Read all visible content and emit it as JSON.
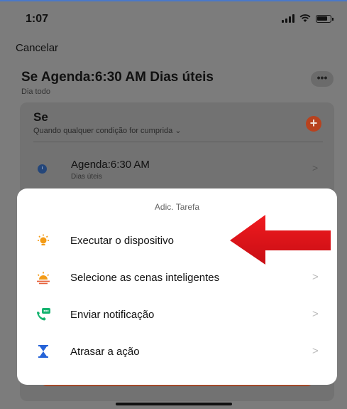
{
  "status_bar": {
    "time": "1:07"
  },
  "header": {
    "cancel_label": "Cancelar"
  },
  "rule": {
    "title": "Se Agenda:6:30 AM Dias úteis",
    "subtitle": "Dia todo",
    "more_label": "•••"
  },
  "condition_section": {
    "title": "Se",
    "subtitle": "Quando qualquer condição for cumprida ⌄",
    "add_label": "+",
    "item": {
      "label": "Agenda:6:30 AM",
      "sub": "Dias úteis",
      "chevron": ">"
    }
  },
  "sheet": {
    "title": "Adic. Tarefa",
    "items": [
      {
        "label": "Executar o dispositivo",
        "icon": "device-icon",
        "chevron": ""
      },
      {
        "label": "Selecione as cenas inteligentes",
        "icon": "scene-icon",
        "chevron": ">"
      },
      {
        "label": "Enviar notificação",
        "icon": "notification-icon",
        "chevron": ">"
      },
      {
        "label": "Atrasar a ação",
        "icon": "hourglass-icon",
        "chevron": ">"
      }
    ]
  },
  "colors": {
    "accent_orange": "#f39b16",
    "notification_green": "#15b36f",
    "hourglass_blue": "#2563d8",
    "arrow_red": "#e0141b"
  }
}
